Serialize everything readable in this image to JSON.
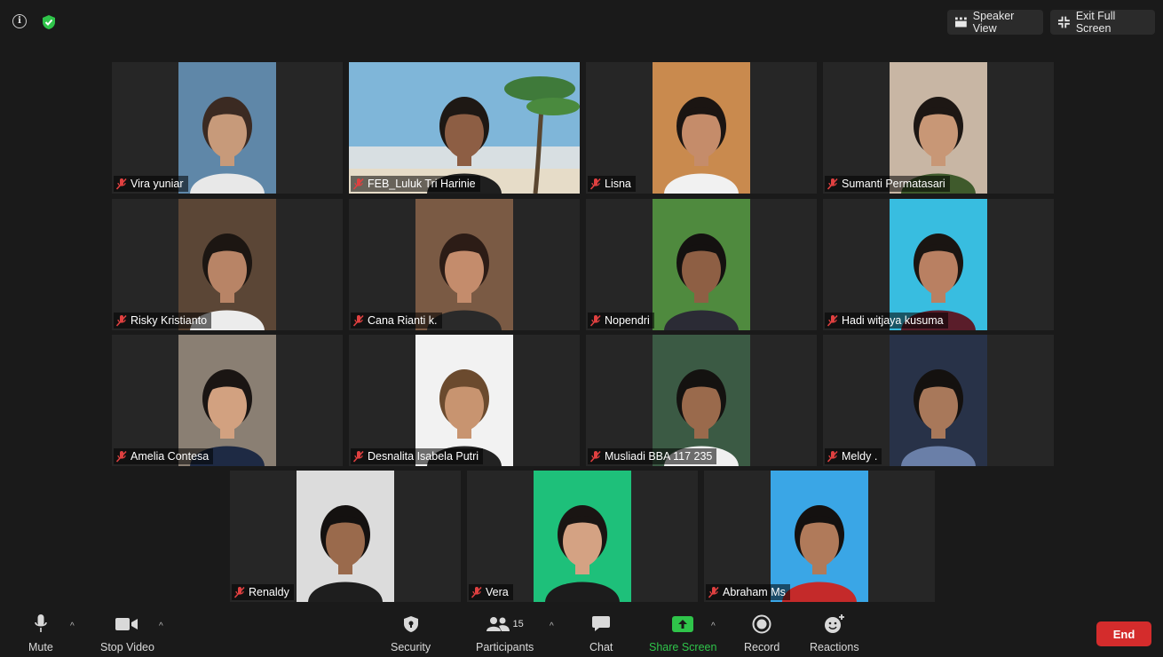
{
  "topbar": {
    "speaker_view": "Speaker View",
    "exit_full_screen": "Exit Full Screen"
  },
  "participants": [
    {
      "name": "Vira yuniar",
      "bg": "#5f87a8",
      "skin": "#c79a7a",
      "hair": "#3b2a22",
      "shirt": "#e8e8e8"
    },
    {
      "name": "FEB_Luluk Tri Harinie",
      "bg": "#7fb6d9",
      "skin": "#8d5e44",
      "hair": "#1e1814",
      "shirt": "#1f1f1f",
      "active": true
    },
    {
      "name": "Lisna",
      "bg": "#c98a4e",
      "skin": "#c58c6a",
      "hair": "#1b1512",
      "shirt": "#f1f1f1"
    },
    {
      "name": "Sumanti Permatasari",
      "bg": "#c8b6a4",
      "skin": "#c89776",
      "hair": "#1d1714",
      "shirt": "#3f5a2c"
    },
    {
      "name": "Risky Kristianto",
      "bg": "#5b4636",
      "skin": "#b88466",
      "hair": "#1c1612",
      "shirt": "#ececec"
    },
    {
      "name": "Cana Rianti k.",
      "bg": "#7a5a44",
      "skin": "#c48c6c",
      "hair": "#2c1c16",
      "shirt": "#2a2a2a"
    },
    {
      "name": "Nopendri",
      "bg": "#4f8a3e",
      "skin": "#8e5f44",
      "hair": "#141110",
      "shirt": "#2b2b35"
    },
    {
      "name": "Hadi witjaya kusuma",
      "bg": "#38bde0",
      "skin": "#b98062",
      "hair": "#1a1512",
      "shirt": "#5a1d2a"
    },
    {
      "name": "Amelia Contesa",
      "bg": "#8a7f73",
      "skin": "#d2a180",
      "hair": "#1a1513",
      "shirt": "#1e2a44"
    },
    {
      "name": "Desnalita Isabela Putri",
      "bg": "#f2f2f2",
      "skin": "#c89470",
      "hair": "#6b4a2e",
      "shirt": "#222"
    },
    {
      "name": "Musliadi BBA 117 235",
      "bg": "#3b5a44",
      "skin": "#9a6a4c",
      "hair": "#141210",
      "shirt": "#f0f0f0"
    },
    {
      "name": "Meldy .",
      "bg": "#283248",
      "skin": "#a8785a",
      "hair": "#14110f",
      "shirt": "#6a7fa8"
    },
    {
      "name": "Renaldy",
      "bg": "#dcdcdc",
      "skin": "#9a6a4c",
      "hair": "#141110",
      "shirt": "#1e1e1e"
    },
    {
      "name": "Vera",
      "bg": "#1ec07a",
      "skin": "#d4a283",
      "hair": "#1a1513",
      "shirt": "#1c1c1c"
    },
    {
      "name": "Abraham Ms",
      "bg": "#3aa6e6",
      "skin": "#b07a5a",
      "hair": "#141110",
      "shirt": "#c42a2a"
    }
  ],
  "controls": {
    "mute": "Mute",
    "stop_video": "Stop Video",
    "security": "Security",
    "participants": "Participants",
    "participant_count": "15",
    "chat": "Chat",
    "share_screen": "Share Screen",
    "record": "Record",
    "reactions": "Reactions",
    "end": "End"
  },
  "colors": {
    "active_speaker": "#c4e35a",
    "share_green": "#2fc44a",
    "end_red": "#d42c2c",
    "mic_off_red": "#e04040"
  }
}
